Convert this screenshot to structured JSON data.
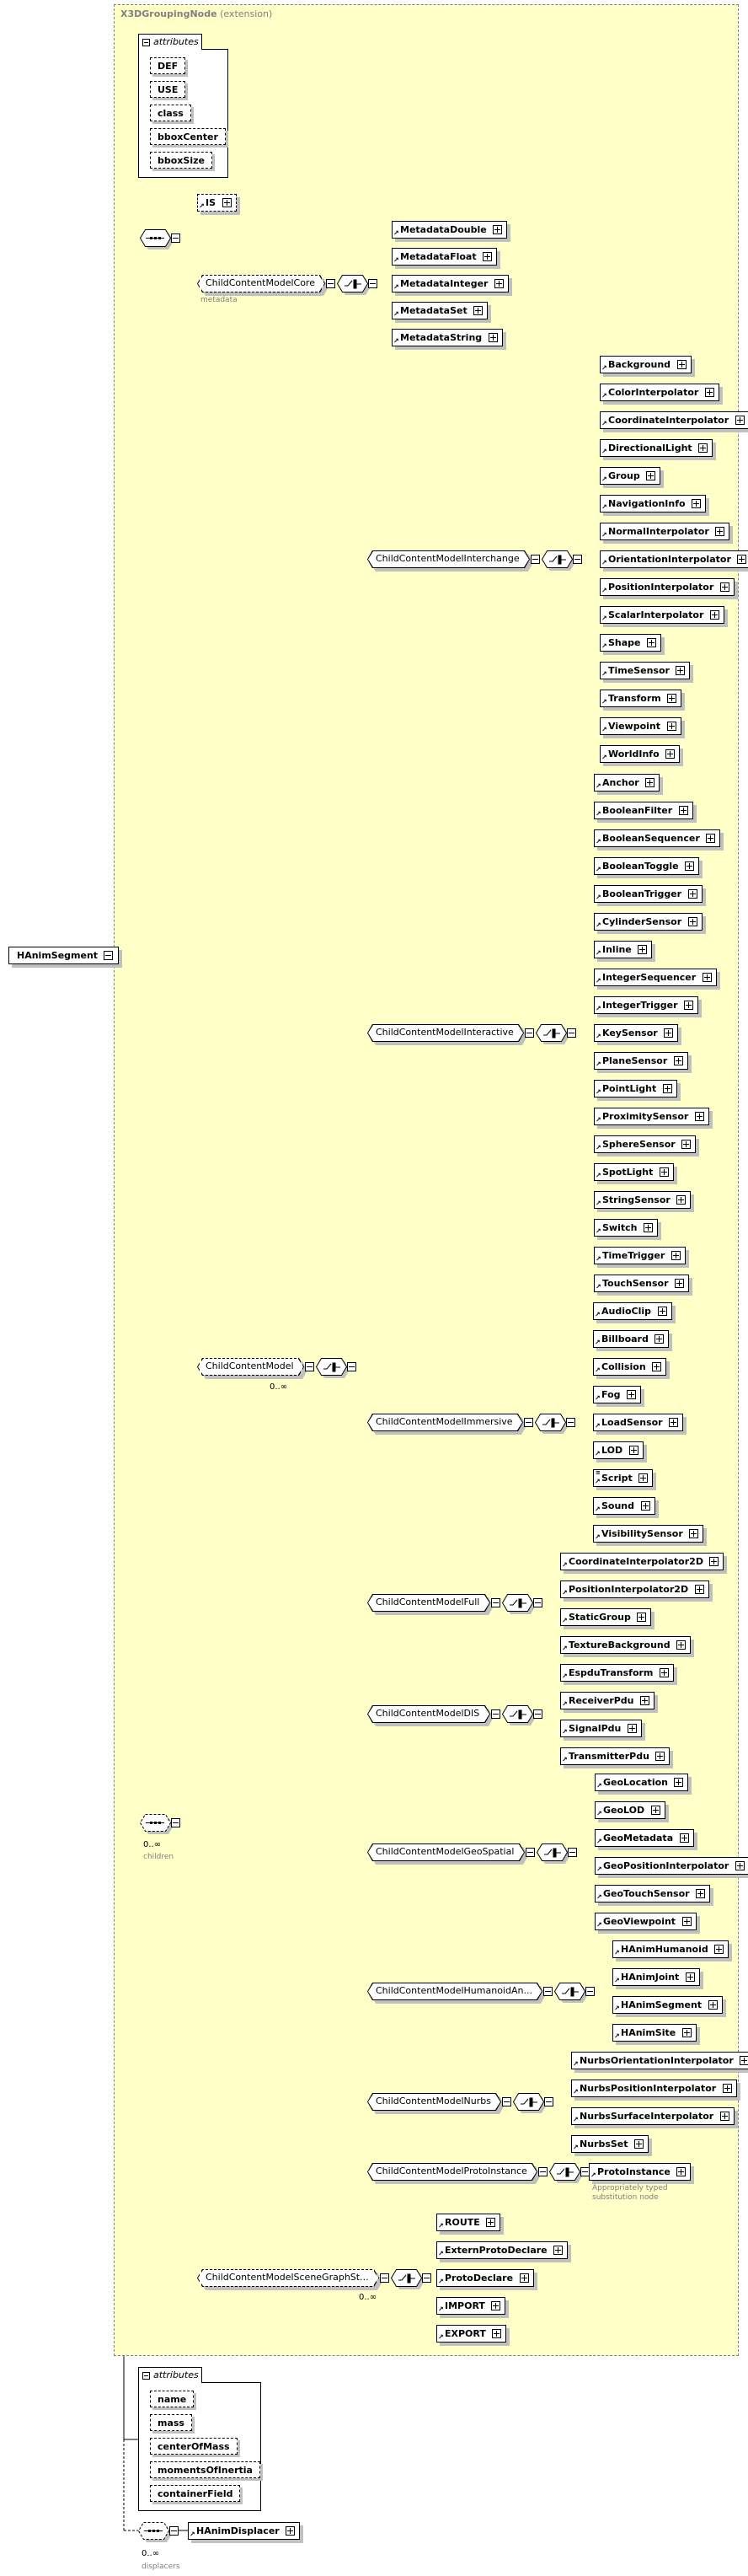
{
  "root": {
    "name": "HAnimSegment"
  },
  "extension": {
    "base": "X3DGroupingNode",
    "suffix": "(extension)"
  },
  "base_attributes": {
    "label": "attributes",
    "items": [
      "DEF",
      "USE",
      "class",
      "bboxCenter",
      "bboxSize"
    ]
  },
  "metadata_sequence": {
    "is_element": "IS",
    "core_group": "ChildContentModelCore",
    "core_group_label": "metadata",
    "core_choices": [
      "MetadataDouble",
      "MetadataFloat",
      "MetadataInteger",
      "MetadataSet",
      "MetadataString"
    ]
  },
  "children_sequence": {
    "occurs": "0..∞",
    "label": "children",
    "child_model": {
      "name": "ChildContentModel",
      "occurs": "0..∞",
      "groups": [
        {
          "name": "ChildContentModelInterchange",
          "items": [
            "Background",
            "ColorInterpolator",
            "CoordinateInterpolator",
            "DirectionalLight",
            "Group",
            "NavigationInfo",
            "NormalInterpolator",
            "OrientationInterpolator",
            "PositionInterpolator",
            "ScalarInterpolator",
            "Shape",
            "TimeSensor",
            "Transform",
            "Viewpoint",
            "WorldInfo"
          ]
        },
        {
          "name": "ChildContentModelInteractive",
          "items": [
            "Anchor",
            "BooleanFilter",
            "BooleanSequencer",
            "BooleanToggle",
            "BooleanTrigger",
            "CylinderSensor",
            "Inline",
            "IntegerSequencer",
            "IntegerTrigger",
            "KeySensor",
            "PlaneSensor",
            "PointLight",
            "ProximitySensor",
            "SphereSensor",
            "SpotLight",
            "StringSensor",
            "Switch",
            "TimeTrigger",
            "TouchSensor"
          ]
        },
        {
          "name": "ChildContentModelImmersive",
          "items": [
            "AudioClip",
            "Billboard",
            "Collision",
            "Fog",
            "LoadSensor",
            "LOD",
            "Script",
            "Sound",
            "VisibilitySensor"
          ]
        },
        {
          "name": "ChildContentModelFull",
          "items": [
            "CoordinateInterpolator2D",
            "PositionInterpolator2D",
            "StaticGroup",
            "TextureBackground"
          ]
        },
        {
          "name": "ChildContentModelDIS",
          "items": [
            "EspduTransform",
            "ReceiverPdu",
            "SignalPdu",
            "TransmitterPdu"
          ]
        },
        {
          "name": "ChildContentModelGeoSpatial",
          "items": [
            "GeoLocation",
            "GeoLOD",
            "GeoMetadata",
            "GeoPositionInterpolator",
            "GeoTouchSensor",
            "GeoViewpoint"
          ]
        },
        {
          "name": "ChildContentModelHumanoidAn...",
          "items": [
            "HAnimHumanoid",
            "HAnimJoint",
            "HAnimSegment",
            "HAnimSite"
          ]
        },
        {
          "name": "ChildContentModelNurbs",
          "items": [
            "NurbsOrientationInterpolator",
            "NurbsPositionInterpolator",
            "NurbsSurfaceInterpolator",
            "NurbsSet"
          ]
        },
        {
          "name": "ChildContentModelProtoInstance",
          "items": [
            "ProtoInstance"
          ],
          "note": "Appropriately typed substitution node"
        }
      ]
    },
    "scene_graph": {
      "name": "ChildContentModelSceneGraphSt...",
      "occurs": "0..∞",
      "items": [
        "ROUTE",
        "ExternProtoDeclare",
        "ProtoDeclare",
        "IMPORT",
        "EXPORT"
      ]
    }
  },
  "own_attributes": {
    "label": "attributes",
    "items": [
      "name",
      "mass",
      "centerOfMass",
      "momentsOfInertia",
      "containerField"
    ]
  },
  "displacers": {
    "occurs": "0..∞",
    "label": "displacers",
    "element": "HAnimDisplacer"
  }
}
